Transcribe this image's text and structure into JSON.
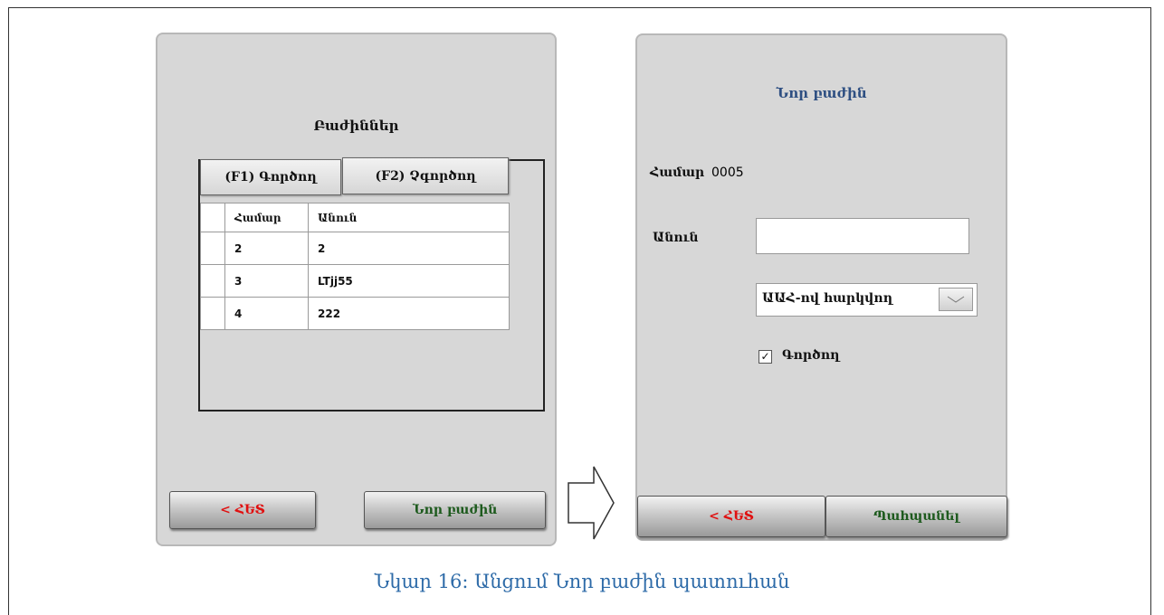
{
  "left_screen": {
    "title": "Բաժիններ",
    "tabs": [
      {
        "label": "(F1) Գործող"
      },
      {
        "label": "(F2) Չգործող"
      }
    ],
    "table": {
      "headers": [
        "Համար",
        "Անուն"
      ],
      "rows": [
        {
          "number": "2",
          "name": "2"
        },
        {
          "number": "3",
          "name": "LTjj55"
        },
        {
          "number": "4",
          "name": "222"
        }
      ]
    },
    "back_button": "< ՀԵՏ",
    "new_button": "Նոր բաժին"
  },
  "right_screen": {
    "title": "Նոր բաժին",
    "number_label": "Համար",
    "number_value": "0005",
    "name_label": "Անուն",
    "name_value": "",
    "currency_select": "ԱԱՀ-ով հարկվող",
    "active_checkbox_label": "Գործող",
    "active_checked": true,
    "back_button": "< ՀԵՏ",
    "save_button": "Պահպանել"
  },
  "caption": "Նկար 16: Անցում Նոր բաժին պատուհան",
  "colors": {
    "panel_bg": "#d7d7d7",
    "back_text": "#e01010",
    "action_text": "#1d5a1d",
    "title_blue": "#2e4f82",
    "caption_blue": "#2e6ba8"
  }
}
